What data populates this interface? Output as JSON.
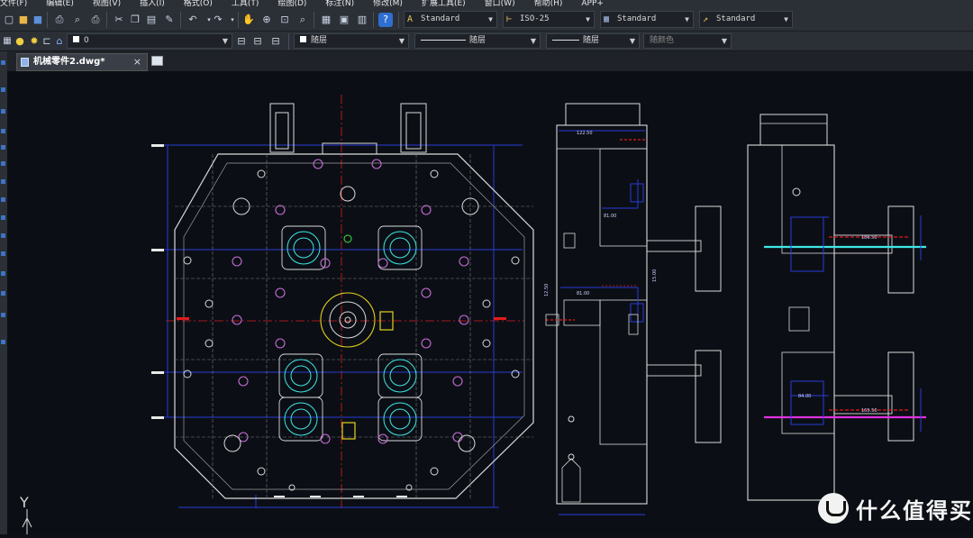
{
  "menu": {
    "items": [
      "文件(F)",
      "编辑(E)",
      "视图(V)",
      "插入(I)",
      "格式(O)",
      "工具(T)",
      "绘图(D)",
      "标注(N)",
      "修改(M)",
      "扩展工具(E)",
      "窗口(W)",
      "帮助(H)",
      "APP+"
    ]
  },
  "toolbar": {
    "text_style": "Standard",
    "dim_style": "ISO-25",
    "table_style": "Standard",
    "mleader_style": "Standard"
  },
  "layers": {
    "current_layer": "0",
    "color": "随层",
    "linetype": "随层",
    "lineweight": "随层",
    "plot_style": "随颜色"
  },
  "tabs": {
    "active_label": "机械零件2.dwg*",
    "close": "×"
  },
  "ucs": {
    "y_label": "Y"
  },
  "dims": {
    "d1": "122.50",
    "d2": "81.00",
    "d3": "81.00",
    "d4": "15.00",
    "d5": "12.50",
    "d6": "186.50",
    "d7": "165.50",
    "d8": "84.00"
  },
  "watermark": {
    "text": "什么值得买"
  },
  "colors": {
    "canvas": "#0b0f15",
    "geometry": "#d9d9d9",
    "blue": "#2a3bd8",
    "red": "#e01b1b",
    "cyan": "#3fe6e6",
    "magenta": "#e030e0",
    "yellow": "#e6d21e",
    "purple": "#b266ff"
  }
}
